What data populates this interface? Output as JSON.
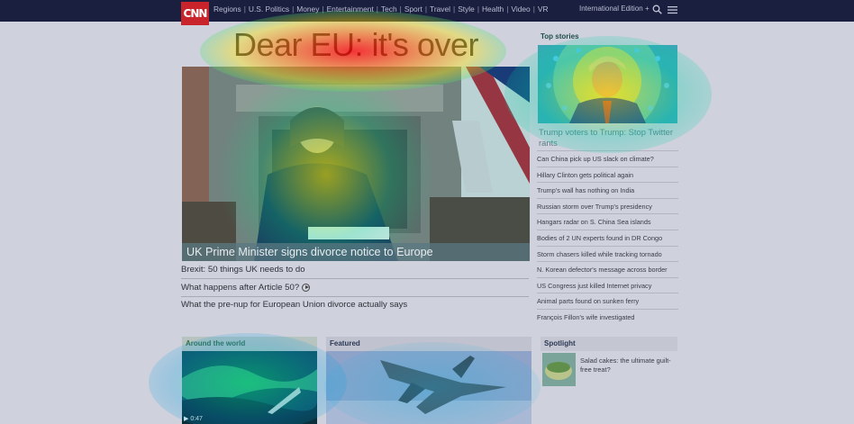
{
  "header": {
    "logo_text": "CNN",
    "nav": [
      "Regions",
      "U.S. Politics",
      "Money",
      "Entertainment",
      "Tech",
      "Sport",
      "Travel",
      "Style",
      "Health",
      "Video",
      "VR"
    ],
    "edition": "International Edition +"
  },
  "headline": "Dear EU: it's over",
  "hero": {
    "caption": "UK Prime Minister signs divorce notice to Europe"
  },
  "related": [
    "Brexit: 50 things UK needs to do",
    "What happens after Article 50?",
    "What the pre-nup for European Union divorce actually says"
  ],
  "top_stories": {
    "title": "Top stories",
    "lead_caption": "Trump voters to Trump: Stop Twitter rants",
    "items": [
      "Can China pick up US slack on climate?",
      "Hillary Clinton gets political again",
      "Trump's wall has nothing on India",
      "Russian storm over Trump's presidency",
      "Hangars radar on S. China Sea islands",
      "Bodies of 2 UN experts found in DR Congo",
      "Storm chasers killed while tracking tornado",
      "N. Korean defector's message across border",
      "US Congress just killed Internet privacy",
      "Animal parts found on sunken ferry",
      "François Fillon's wife investigated"
    ]
  },
  "sections": {
    "world": "Around the world",
    "featured": "Featured",
    "spotlight": "Spotlight",
    "world_video_time": "0:47",
    "spotlight_text": "Salad cakes: the ultimate guilt-free treat?"
  },
  "colors": {
    "nav_bg": "#1b1f3f",
    "logo_red": "#c9242b",
    "page_bg": "#cfd1dc"
  }
}
